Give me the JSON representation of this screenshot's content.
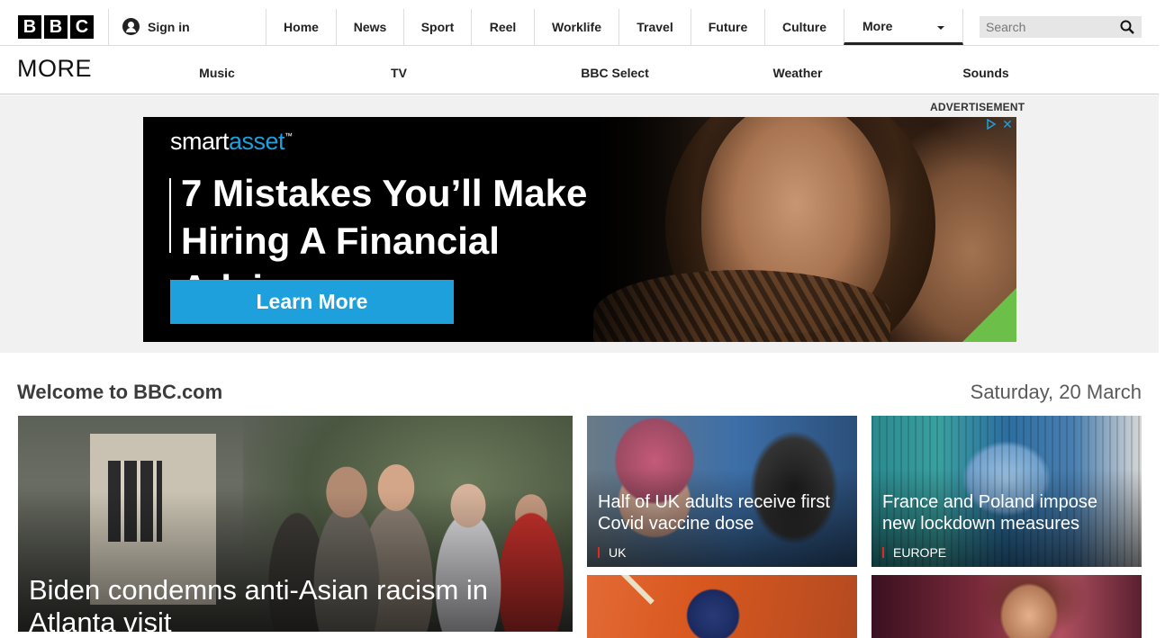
{
  "header": {
    "logo_letters": [
      "B",
      "B",
      "C"
    ],
    "sign_in_label": "Sign in",
    "nav": [
      "Home",
      "News",
      "Sport",
      "Reel",
      "Worklife",
      "Travel",
      "Future",
      "Culture"
    ],
    "more_label": "More",
    "search_placeholder": "Search"
  },
  "subnav": {
    "section_title": "MORE",
    "items": [
      "Music",
      "TV",
      "BBC Select",
      "Weather",
      "Sounds"
    ]
  },
  "ad": {
    "label": "ADVERTISEMENT",
    "brand_part1": "smart",
    "brand_part2": "asset",
    "brand_mark": "™",
    "headline_line1": "7 Mistakes You’ll Make",
    "headline_line2": "Hiring A Financial Advisor",
    "cta": "Learn More",
    "close_symbol": "✕",
    "accent_color": "#1ea0dc"
  },
  "welcome": {
    "heading": "Welcome to BBC.com",
    "date": "Saturday, 20 March"
  },
  "stories": {
    "main": {
      "title": "Biden condemns anti-Asian racism in Atlanta visit"
    },
    "uk": {
      "title": "Half of UK adults receive first Covid vaccine dose",
      "tag": "UK"
    },
    "europe": {
      "title": "France and Poland impose new lockdown measures",
      "tag": "EUROPE"
    }
  }
}
